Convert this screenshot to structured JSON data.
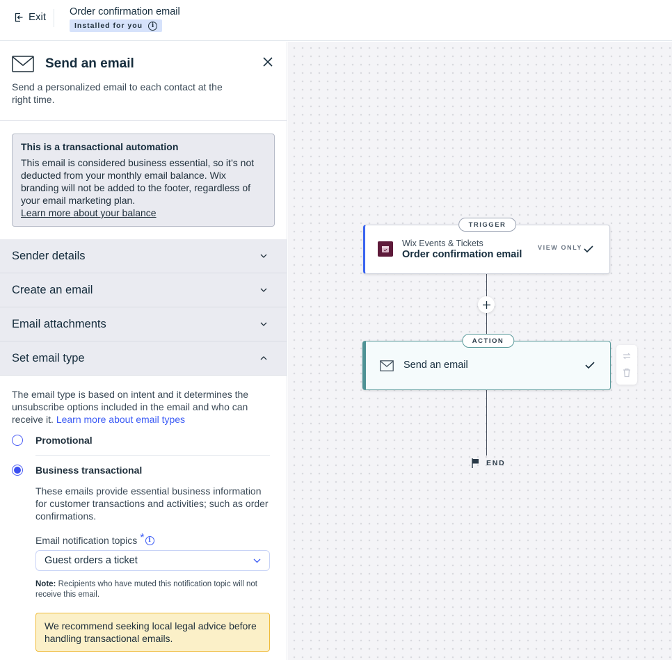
{
  "header": {
    "exit_label": "Exit",
    "title": "Order confirmation email",
    "badge": "Installed for you",
    "badge_icon": "info-icon"
  },
  "panel": {
    "title": "Send an email",
    "title_icon": "envelope-icon",
    "description": "Send a personalized email to each contact at the right time.",
    "close_icon": "close-icon",
    "notice": {
      "title": "This is a transactional automation",
      "body": "This email is considered business essential, so it’s not deducted from your monthly email balance. Wix branding will not be added to the footer, regardless of your email marketing plan.",
      "link": "Learn more about your balance"
    },
    "accordions": [
      {
        "label": "Sender details",
        "expanded": false
      },
      {
        "label": "Create an email",
        "expanded": false
      },
      {
        "label": "Email attachments",
        "expanded": false
      },
      {
        "label": "Set email type",
        "expanded": true
      }
    ],
    "email_type": {
      "description": "The email type is based on intent and it determines the unsubscribe options included in the email and who can receive it.",
      "link": "Learn more about email types",
      "options": [
        {
          "label": "Promotional",
          "selected": false
        },
        {
          "label": "Business transactional",
          "selected": true,
          "description": "These emails provide essential business information for customer transactions and activities; such as order confirmations."
        }
      ],
      "topics_label": "Email notification topics",
      "required_mark": "*",
      "topics_value": "Guest orders a ticket",
      "note_prefix": "Note:",
      "note": " Recipients who have muted this notification topic will not receive this email.",
      "warning": "We recommend seeking local legal advice before handling transactional emails."
    }
  },
  "canvas": {
    "trigger": {
      "tag": "TRIGGER",
      "app": "Wix Events & Tickets",
      "name": "Order confirmation email",
      "status": "VIEW ONLY",
      "app_icon": "calendar-icon",
      "brand_color": "#5e1a3a",
      "accent": "#3a64f0"
    },
    "action": {
      "tag": "ACTION",
      "name": "Send an email",
      "icon": "envelope-icon",
      "accent": "#4e9295"
    },
    "end_label": "END",
    "tools": [
      "replace-icon",
      "trash-icon"
    ]
  }
}
